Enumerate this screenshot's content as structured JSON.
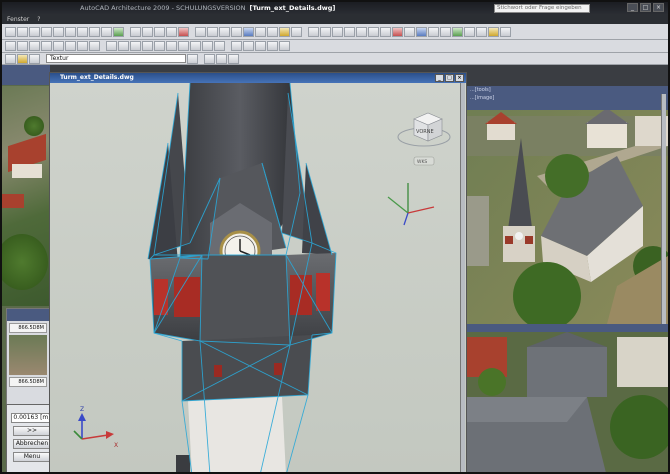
{
  "window": {
    "app_title": "AutoCAD Architecture 2009 - SCHULUNGSVERSION",
    "doc_title": "[Turm_ext_Details.dwg]",
    "search_placeholder": "Stichwort oder Frage eingeben"
  },
  "menu": {
    "items": [
      "Fenster",
      "?"
    ]
  },
  "toolbar": {
    "layer_value": "Textur"
  },
  "drawing_window": {
    "title": "Turm_ext_Details.dwg"
  },
  "viewcube": {
    "face_label": "VORNE",
    "compass_label": "WKS"
  },
  "ucs": {
    "z": "Z",
    "x": "X"
  },
  "left_panel": {
    "rows": [
      "866.5D8M",
      "866.5D8M"
    ]
  },
  "cmd_panel": {
    "value": "0.00163 [m]",
    "next": ">>",
    "cancel": "Abbrechen",
    "menu": "Menu"
  },
  "right_panel": {
    "top_labels": [
      "...[tools]",
      "...[image]"
    ]
  },
  "colors": {
    "title_active": "#3a64a8",
    "mesh_line": "#2aa8d8",
    "roof_red": "#a8412e"
  }
}
